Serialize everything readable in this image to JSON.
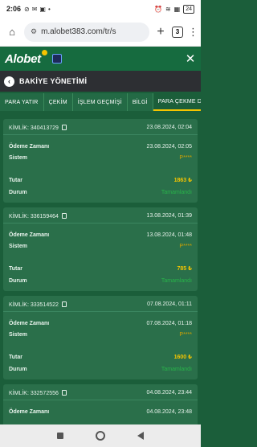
{
  "status_bar": {
    "time": "2:06",
    "battery": "24"
  },
  "browser": {
    "url": "m.alobet383.com/tr/s",
    "tab_count": "3"
  },
  "app": {
    "logo_text": "Alobet"
  },
  "section": {
    "title": "BAKİYE YÖNETİMİ"
  },
  "tabs": [
    {
      "label": "PARA YATIR"
    },
    {
      "label": "ÇEKİM"
    },
    {
      "label": "İŞLEM GEÇMİŞİ"
    },
    {
      "label": "BİLGİ"
    },
    {
      "label": "PARA ÇEKME DU"
    }
  ],
  "labels": {
    "id": "KİMLİK:",
    "payment_time": "Ödeme Zamanı",
    "system": "Sistem",
    "amount": "Tutar",
    "status": "Durum"
  },
  "transactions": [
    {
      "id": "340413729",
      "created": "23.08.2024, 02:04",
      "payment_time": "23.08.2024, 02:05",
      "system": "P****",
      "amount": "1863 ₺",
      "status": "Tamamlandı"
    },
    {
      "id": "336159464",
      "created": "13.08.2024, 01:39",
      "payment_time": "13.08.2024, 01:48",
      "system": "P****",
      "amount": "785 ₺",
      "status": "Tamamlandı"
    },
    {
      "id": "333514522",
      "created": "07.08.2024, 01:11",
      "payment_time": "07.08.2024, 01:18",
      "system": "P****",
      "amount": "1600 ₺",
      "status": "Tamamlandı"
    },
    {
      "id": "332572556",
      "created": "04.08.2024, 23:44",
      "payment_time": "04.08.2024, 23:48",
      "system": "",
      "amount": "",
      "status": ""
    }
  ],
  "colors": {
    "brand_green": "#166b3f",
    "accent_yellow": "#f5c400",
    "status_green": "#29b34a"
  }
}
